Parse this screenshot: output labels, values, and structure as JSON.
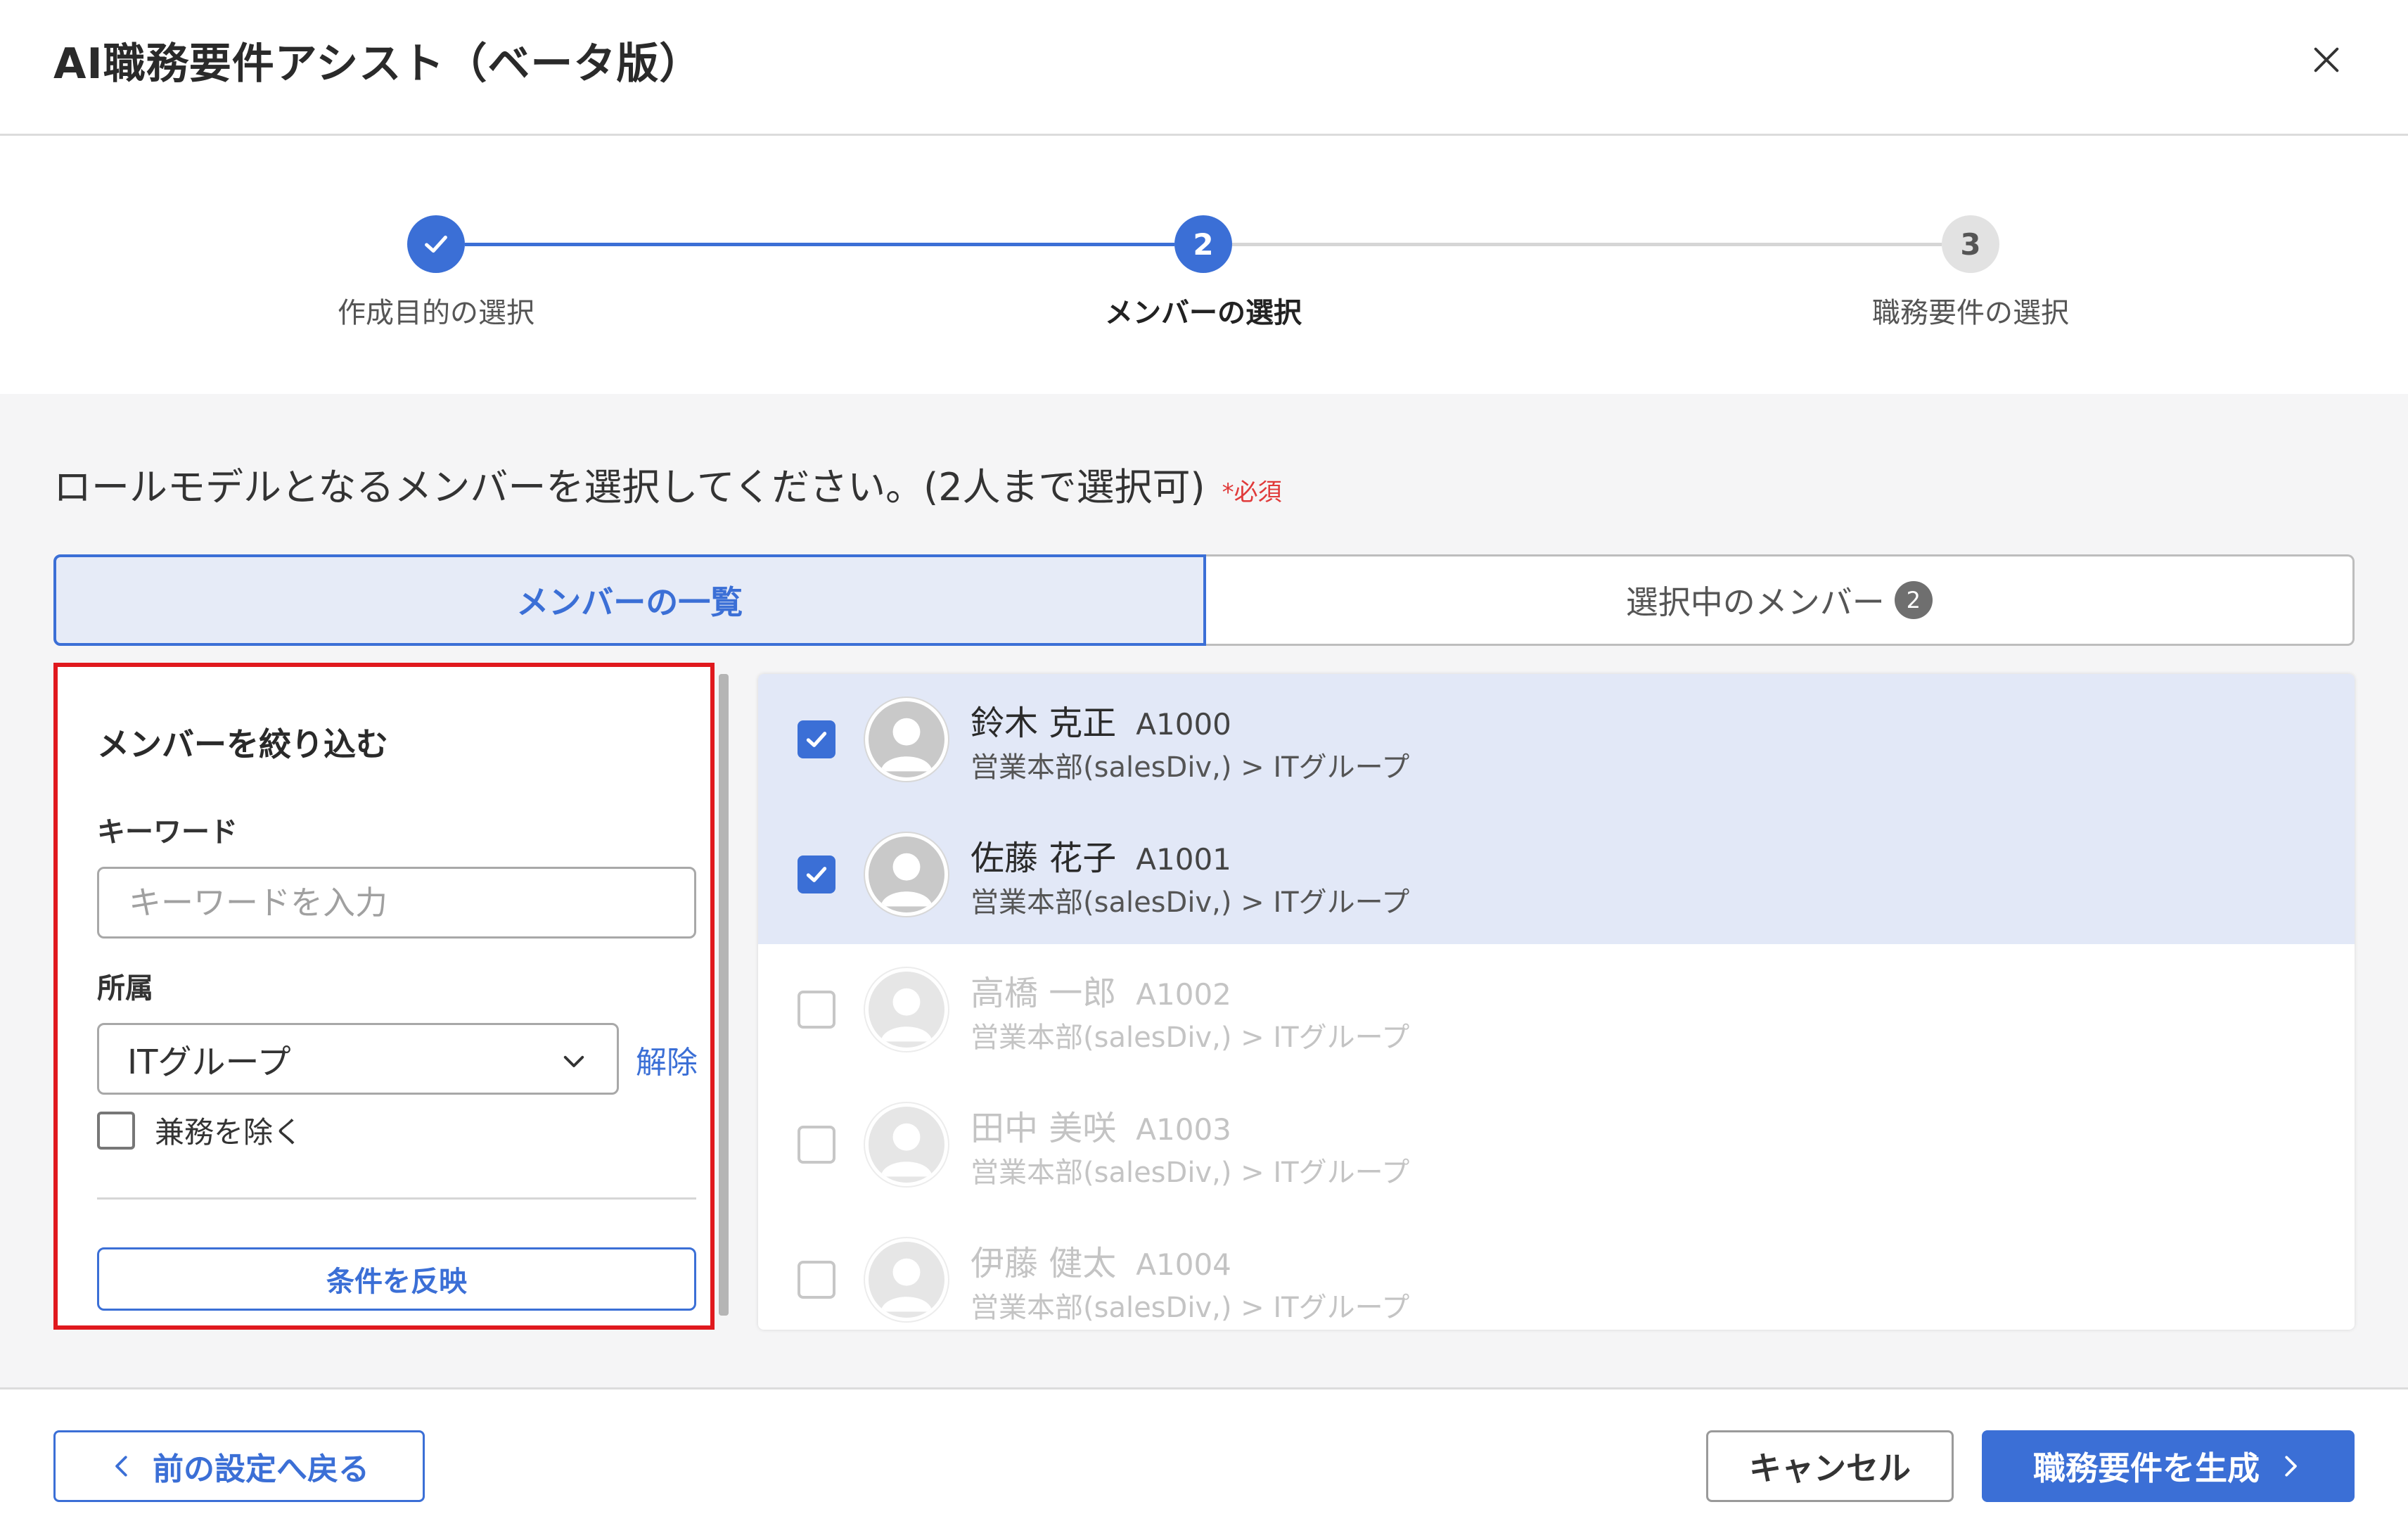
{
  "header": {
    "title": "AI職務要件アシスト（ベータ版）",
    "close_icon": "close-icon"
  },
  "stepper": {
    "steps": [
      {
        "label": "作成目的の選択",
        "state": "done",
        "icon": "check-icon"
      },
      {
        "label": "メンバーの選択",
        "state": "active",
        "number": "2"
      },
      {
        "label": "職務要件の選択",
        "state": "todo",
        "number": "3"
      }
    ]
  },
  "instruction": {
    "text": "ロールモデルとなるメンバーを選択してください。(2人まで選択可)",
    "required": "*必須"
  },
  "tabs": {
    "members_list": "メンバーの一覧",
    "selected_members": "選択中のメンバー",
    "selected_count": "2"
  },
  "filter": {
    "title": "メンバーを絞り込む",
    "keyword_label": "キーワード",
    "keyword_placeholder": "キーワードを入力",
    "keyword_value": "",
    "affiliation_label": "所属",
    "affiliation_value": "ITグループ",
    "clear_label": "解除",
    "exclude_concurrent_label": "兼務を除く",
    "exclude_concurrent_checked": false,
    "apply_label": "条件を反映"
  },
  "members": [
    {
      "name": "鈴木 克正",
      "id": "A1000",
      "dept": "営業本部(salesDiv,) > ITグループ",
      "checked": true
    },
    {
      "name": "佐藤 花子",
      "id": "A1001",
      "dept": "営業本部(salesDiv,) > ITグループ",
      "checked": true
    },
    {
      "name": "高橋 一郎",
      "id": "A1002",
      "dept": "営業本部(salesDiv,) > ITグループ",
      "checked": false
    },
    {
      "name": "田中 美咲",
      "id": "A1003",
      "dept": "営業本部(salesDiv,) > ITグループ",
      "checked": false
    },
    {
      "name": "伊藤 健太",
      "id": "A1004",
      "dept": "営業本部(salesDiv,) > ITグループ",
      "checked": false
    }
  ],
  "footer": {
    "back_label": "前の設定へ戻る",
    "cancel_label": "キャンセル",
    "generate_label": "職務要件を生成"
  },
  "colors": {
    "accent": "#3b6fd6",
    "highlight_border": "#e0191e",
    "selected_row": "#e2e8f7",
    "required": "#e03a3a"
  }
}
